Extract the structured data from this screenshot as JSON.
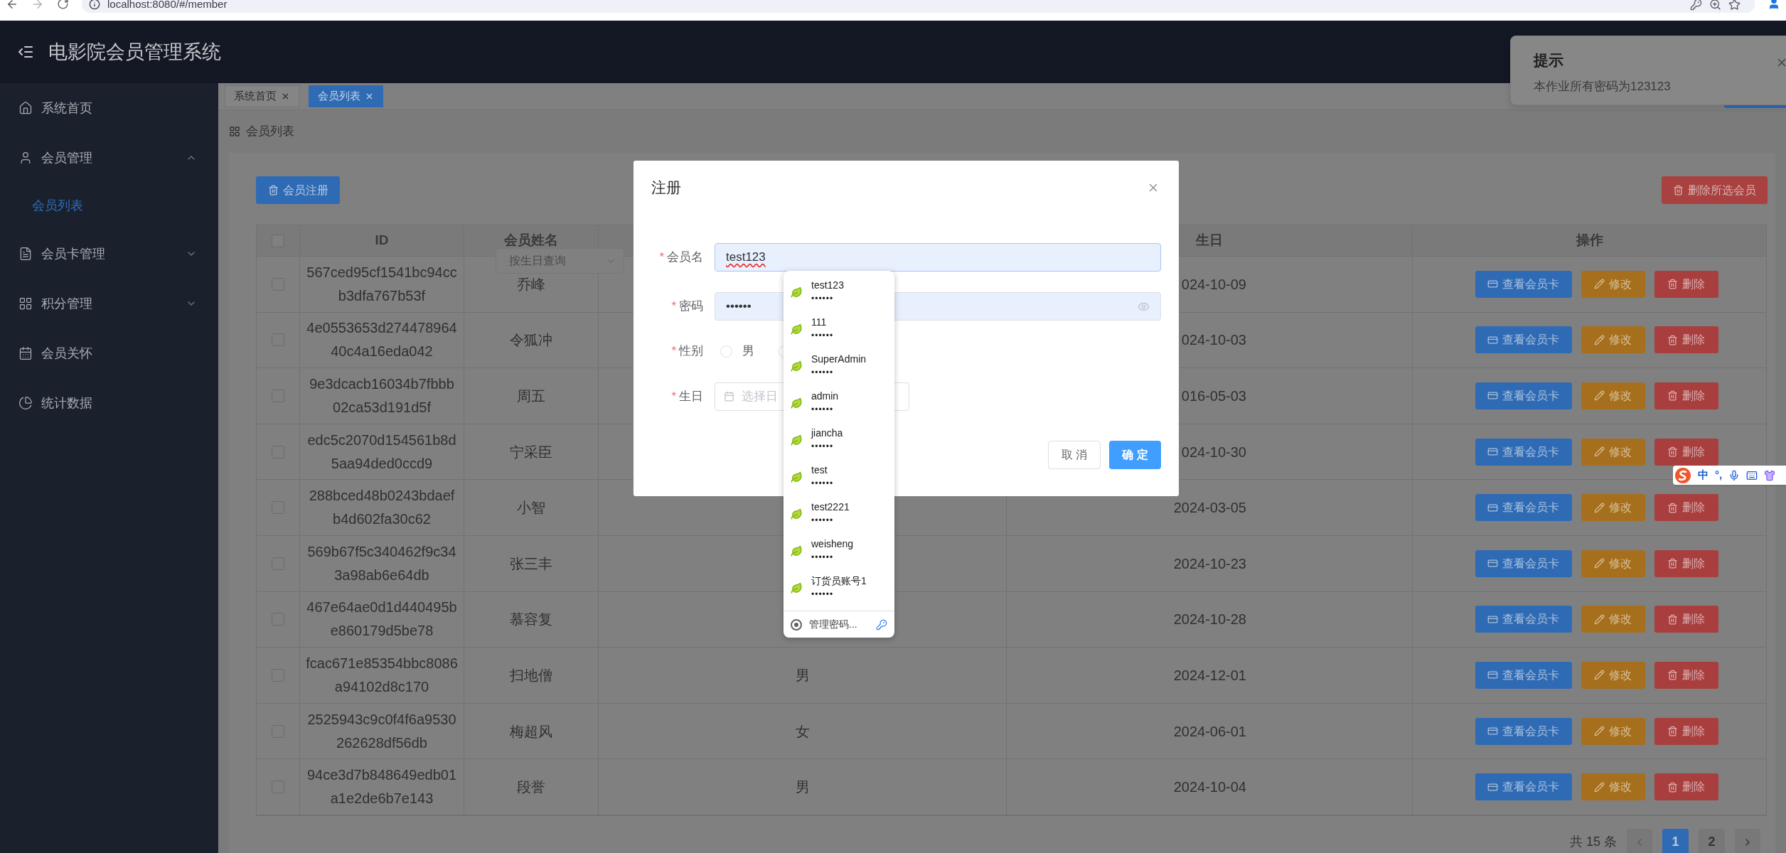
{
  "browser": {
    "url": "localhost:8080/#/member"
  },
  "header": {
    "title": "电影院会员管理系统"
  },
  "notification": {
    "title": "提示",
    "message": "本作业所有密码为123123"
  },
  "sidebar": {
    "items": [
      {
        "label": "系统首页",
        "kind": "link",
        "selected": false
      },
      {
        "label": "会员管理",
        "kind": "group",
        "expanded": true,
        "selected": false,
        "children": [
          {
            "label": "会员列表",
            "selected": true
          }
        ]
      },
      {
        "label": "会员卡管理",
        "kind": "group",
        "expanded": false,
        "selected": false
      },
      {
        "label": "积分管理",
        "kind": "group",
        "expanded": false,
        "selected": false
      },
      {
        "label": "会员关怀",
        "kind": "link",
        "selected": false
      },
      {
        "label": "统计数据",
        "kind": "link",
        "selected": false
      }
    ]
  },
  "tabs": [
    {
      "label": "系统首页",
      "selected": false
    },
    {
      "label": "会员列表",
      "selected": true
    }
  ],
  "breadcrumb": "会员列表",
  "toolbar": {
    "register": "会员注册",
    "delete_selected": "删除所选会员"
  },
  "filter": {
    "placeholder": "按生日查询"
  },
  "table": {
    "select_all_checked": false,
    "columns": {
      "id": "ID",
      "name": "会员姓名",
      "birthday": "生日",
      "actions": "操作"
    },
    "rows": [
      {
        "checked": false,
        "id": "567ced95cf1541bc94ccb3dfa767b53f",
        "name": "乔峰",
        "birthday": "024-10-09",
        "actions": [
          {
            "kind": "view",
            "label": "查看会员卡"
          },
          {
            "kind": "edit",
            "label": "修改"
          },
          {
            "kind": "delete",
            "label": "删除"
          }
        ]
      },
      {
        "checked": false,
        "id": "4e0553653d27447896440c4a16eda042",
        "name": "令狐冲",
        "birthday": "024-10-03",
        "actions": [
          {
            "kind": "view",
            "label": "查看会员卡"
          },
          {
            "kind": "edit",
            "label": "修改"
          },
          {
            "kind": "delete",
            "label": "删除"
          }
        ]
      },
      {
        "checked": false,
        "id": "9e3dcacb16034b7fbbb02ca53d191d5f",
        "name": "周五",
        "birthday": "016-05-03",
        "actions": [
          {
            "kind": "view",
            "label": "查看会员卡"
          },
          {
            "kind": "edit",
            "label": "修改"
          },
          {
            "kind": "delete",
            "label": "删除"
          }
        ]
      },
      {
        "checked": false,
        "id": "edc5c2070d154561b8d5aa94ded0ccd9",
        "name": "宁采臣",
        "birthday": "024-10-30",
        "actions": [
          {
            "kind": "view",
            "label": "查看会员卡"
          },
          {
            "kind": "edit",
            "label": "修改"
          },
          {
            "kind": "delete",
            "label": "删除"
          }
        ]
      },
      {
        "checked": false,
        "id": "288bced48b0243bdaefb4d602fa30c62",
        "name": "小智",
        "birthday": "2024-03-05",
        "actions": [
          {
            "kind": "view",
            "label": "查看会员卡"
          },
          {
            "kind": "edit",
            "label": "修改"
          },
          {
            "kind": "delete",
            "label": "删除"
          }
        ]
      },
      {
        "checked": false,
        "id": "569b67f5c340462f9c343a98ab6e64db",
        "name": "张三丰",
        "birthday": "2024-10-23",
        "actions": [
          {
            "kind": "view",
            "label": "查看会员卡"
          },
          {
            "kind": "edit",
            "label": "修改"
          },
          {
            "kind": "delete",
            "label": "删除"
          }
        ]
      },
      {
        "checked": false,
        "id": "467e64ae0d1d440495be860179d5be78",
        "name": "慕容复",
        "birthday": "2024-10-28",
        "actions": [
          {
            "kind": "view",
            "label": "查看会员卡"
          },
          {
            "kind": "edit",
            "label": "修改"
          },
          {
            "kind": "delete",
            "label": "删除"
          }
        ]
      },
      {
        "checked": false,
        "id": "fcac671e85354bbc8086a94102d8c170",
        "name": "扫地僧",
        "gender": "男",
        "birthday": "2024-12-01",
        "actions": [
          {
            "kind": "view",
            "label": "查看会员卡"
          },
          {
            "kind": "edit",
            "label": "修改"
          },
          {
            "kind": "delete",
            "label": "删除"
          }
        ]
      },
      {
        "checked": false,
        "id": "2525943c9c0f4f6a9530262628df56db",
        "name": "梅超风",
        "gender": "女",
        "birthday": "2024-06-01",
        "actions": [
          {
            "kind": "view",
            "label": "查看会员卡"
          },
          {
            "kind": "edit",
            "label": "修改"
          },
          {
            "kind": "delete",
            "label": "删除"
          }
        ]
      },
      {
        "checked": false,
        "id": "94ce3d7b848649edb01a1e2de6b7e143",
        "name": "段誉",
        "gender": "男",
        "birthday": "2024-10-04",
        "actions": [
          {
            "kind": "view",
            "label": "查看会员卡"
          },
          {
            "kind": "edit",
            "label": "修改"
          },
          {
            "kind": "delete",
            "label": "删除"
          }
        ]
      }
    ]
  },
  "pagination": {
    "total": "共 15 条",
    "pages": [
      {
        "label": "1",
        "selected": true
      },
      {
        "label": "2",
        "selected": false
      }
    ]
  },
  "dialog": {
    "title": "注册",
    "username": {
      "mark": "*",
      "label": "会员名",
      "value": "test123"
    },
    "password": {
      "mark": "*",
      "label": "密码",
      "value": "••••••"
    },
    "gender": {
      "mark": "*",
      "label": "性别",
      "options": [
        {
          "label": "男",
          "selected": false
        },
        {
          "selected": false
        }
      ]
    },
    "birthday": {
      "mark": "*",
      "label": "生日",
      "placeholder": "选择日"
    },
    "cancel": "取 消",
    "confirm": "确 定"
  },
  "autofill": {
    "accounts": [
      {
        "username": "test123",
        "masked": "••••••"
      },
      {
        "username": "111",
        "masked": "••••••"
      },
      {
        "username": "SuperAdmin",
        "masked": "••••••"
      },
      {
        "username": "admin",
        "masked": "••••••"
      },
      {
        "username": "jiancha",
        "masked": "••••••"
      },
      {
        "username": "test",
        "masked": "••••••"
      },
      {
        "username": "test2221",
        "masked": "••••••"
      },
      {
        "username": "weisheng",
        "masked": "••••••"
      },
      {
        "username": "订货员账号1",
        "masked": "••••••"
      }
    ],
    "manage": "管理密码..."
  },
  "ime_toolbar": {
    "items": [
      "中",
      "°,"
    ]
  }
}
